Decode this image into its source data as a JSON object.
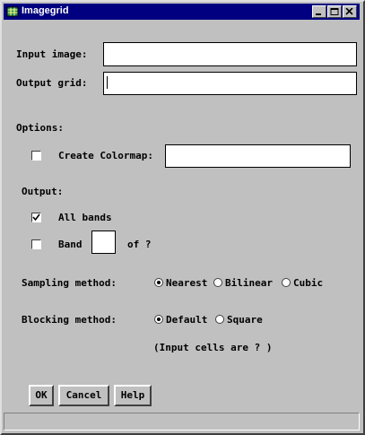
{
  "window": {
    "title": "Imagegrid"
  },
  "fields": {
    "input_image": {
      "label": "Input image:",
      "value": ""
    },
    "output_grid": {
      "label": "Output grid:",
      "value": ""
    }
  },
  "options": {
    "heading": "Options:",
    "create_colormap": {
      "label": "Create Colormap:",
      "checked": false,
      "value": ""
    },
    "output_heading": "Output:",
    "all_bands": {
      "label": "All bands",
      "checked": true
    },
    "band": {
      "label": "Band",
      "checked": false,
      "value": "",
      "of_label": "of ?"
    },
    "sampling": {
      "label": "Sampling method:",
      "options": [
        "Nearest",
        "Bilinear",
        "Cubic"
      ],
      "selected": "Nearest"
    },
    "blocking": {
      "label": "Blocking method:",
      "options": [
        "Default",
        "Square"
      ],
      "selected": "Default"
    },
    "input_cells_note": "(Input cells are ? )"
  },
  "buttons": {
    "ok": "OK",
    "cancel": "Cancel",
    "help": "Help"
  },
  "icons": {
    "app": "grid-app-icon",
    "minimize": "minimize-icon",
    "maximize": "maximize-icon",
    "close": "close-icon"
  }
}
